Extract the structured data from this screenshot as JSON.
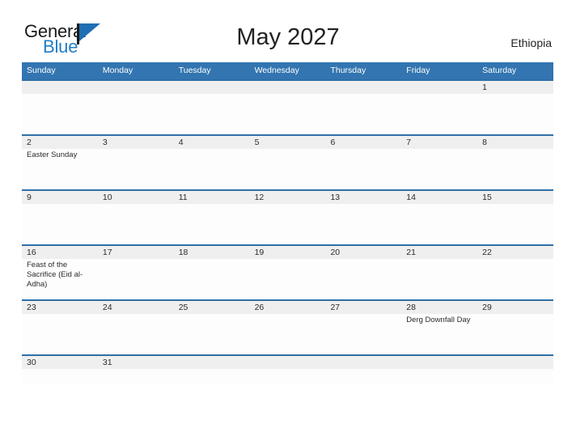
{
  "brand": {
    "name_part1": "General",
    "name_part2": "Blue",
    "flag_icon": "flag-triangle-icon",
    "accent_color": "#1f6fb2"
  },
  "header": {
    "title": "May 2027",
    "country": "Ethiopia"
  },
  "theme": {
    "header_blue": "#3275b0",
    "row_divider_blue": "#2f6fa8",
    "date_band_gray": "#efefef",
    "cell_background": "#fdfdfd",
    "text_color": "#2b2b2b"
  },
  "calendar": {
    "month": "May",
    "year": "2027",
    "weekday_headers": [
      "Sunday",
      "Monday",
      "Tuesday",
      "Wednesday",
      "Thursday",
      "Friday",
      "Saturday"
    ],
    "weeks": [
      {
        "dates": [
          "",
          "",
          "",
          "",
          "",
          "",
          "1"
        ],
        "events": [
          [],
          [],
          [],
          [],
          [],
          [],
          []
        ]
      },
      {
        "dates": [
          "2",
          "3",
          "4",
          "5",
          "6",
          "7",
          "8"
        ],
        "events": [
          [
            "Easter Sunday"
          ],
          [],
          [],
          [],
          [],
          [],
          []
        ]
      },
      {
        "dates": [
          "9",
          "10",
          "11",
          "12",
          "13",
          "14",
          "15"
        ],
        "events": [
          [],
          [],
          [],
          [],
          [],
          [],
          []
        ]
      },
      {
        "dates": [
          "16",
          "17",
          "18",
          "19",
          "20",
          "21",
          "22"
        ],
        "events": [
          [
            "Feast of the Sacrifice (Eid al-Adha)"
          ],
          [],
          [],
          [],
          [],
          [],
          []
        ]
      },
      {
        "dates": [
          "23",
          "24",
          "25",
          "26",
          "27",
          "28",
          "29"
        ],
        "events": [
          [],
          [],
          [],
          [],
          [],
          [
            "Derg Downfall Day"
          ],
          []
        ]
      },
      {
        "dates": [
          "30",
          "31",
          "",
          "",
          "",
          "",
          ""
        ],
        "events": [
          [],
          [],
          [],
          [],
          [],
          [],
          []
        ]
      }
    ]
  }
}
